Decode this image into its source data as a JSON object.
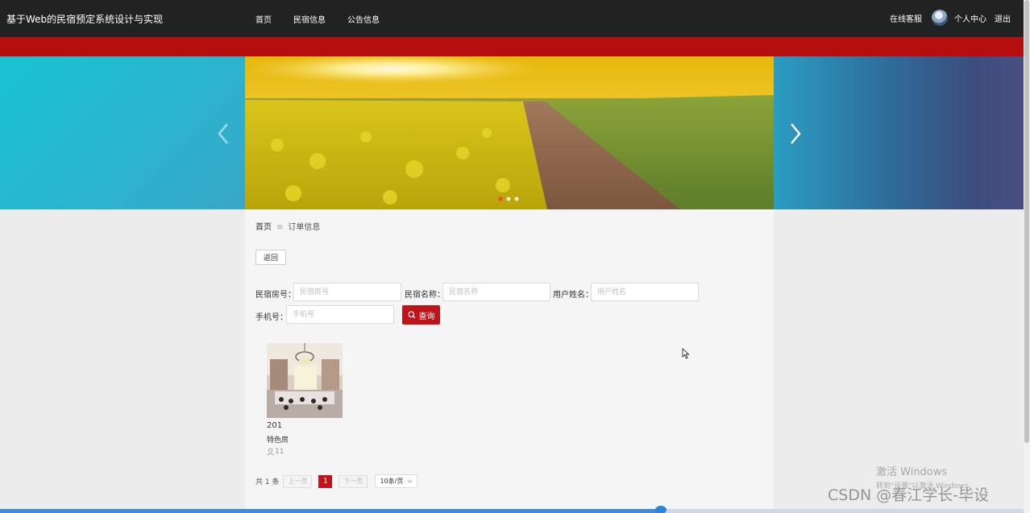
{
  "header": {
    "site_title": "基于Web的民宿预定系统设计与实现",
    "nav": [
      "首页",
      "民宿信息",
      "公告信息"
    ],
    "online_service": "在线客服",
    "profile": "个人中心",
    "logout": "退出"
  },
  "breadcrumb": {
    "home": "首页",
    "separator": "≡",
    "current": "订单信息"
  },
  "back_button": "返回",
  "search_form": {
    "room_no": {
      "label": "民宿房号：",
      "placeholder": "民宿房号"
    },
    "homestay_name": {
      "label": "民宿名称：",
      "placeholder": "民宿名称"
    },
    "user_name": {
      "label": "用户姓名：",
      "placeholder": "用户姓名"
    },
    "phone": {
      "label": "手机号：",
      "placeholder": "手机号"
    },
    "search_button": "查询"
  },
  "orders": [
    {
      "room_no": "201",
      "room_type": "特色房",
      "count": "11"
    }
  ],
  "pagination": {
    "total": "共 1 条",
    "prev": "上一页",
    "current_page": "1",
    "next": "下一页",
    "page_size": "10条/页"
  },
  "carousel": {
    "slide_count": 3,
    "active_index": 0
  },
  "colors": {
    "accent": "#c0141b",
    "header_bg": "#222222",
    "red_bar": "#b60e0e"
  },
  "overlay": {
    "activate_title": "激活 Windows",
    "activate_sub": "转到\"设置\"以激活 Windows。",
    "watermark": "CSDN @春江学长-毕设"
  }
}
